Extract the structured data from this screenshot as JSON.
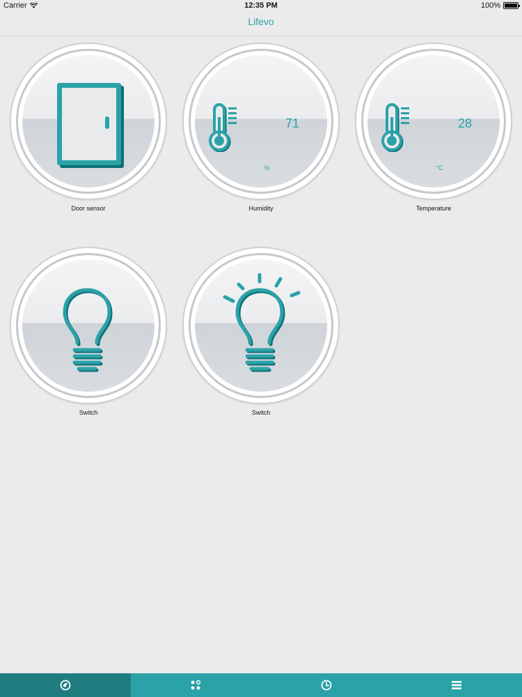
{
  "status_bar": {
    "carrier": "Carrier",
    "time": "12:35 PM",
    "battery": "100%"
  },
  "header": {
    "title": "Lifevo"
  },
  "devices": [
    {
      "label": "Door sensor",
      "icon": "door-icon"
    },
    {
      "label": "Humidity",
      "icon": "thermometer-icon",
      "value": "71",
      "unit": "%"
    },
    {
      "label": "Temperature",
      "icon": "thermometer-icon",
      "value": "28",
      "unit": "°C"
    },
    {
      "label": "Switch",
      "icon": "lightbulb-off-icon"
    },
    {
      "label": "Switch",
      "icon": "lightbulb-on-icon"
    }
  ],
  "tab_bar": {
    "tabs": [
      {
        "icon": "home-icon",
        "active": true
      },
      {
        "icon": "grid-icon",
        "active": false
      },
      {
        "icon": "clock-icon",
        "active": false
      },
      {
        "icon": "menu-icon",
        "active": false
      }
    ]
  },
  "colors": {
    "accent": "#2aa2a8",
    "accent_dark": "#1f7d80",
    "background": "#ebebeb"
  }
}
